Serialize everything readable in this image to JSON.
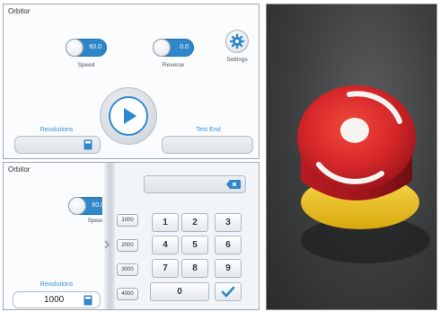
{
  "top_panel": {
    "title": "Orbitor",
    "speed": {
      "value": "60.0",
      "label": "Speed"
    },
    "reverse": {
      "value": "0.0",
      "label": "Reverse"
    },
    "settings_label": "Settings",
    "revolutions_label": "Revolutions",
    "test_end_label": "Test End"
  },
  "bottom_panel": {
    "title": "Orbitor",
    "speed": {
      "value": "60.0",
      "label": "Speed"
    },
    "revolutions_label": "Revolutions",
    "revolutions_value": "1000",
    "presets": [
      "1000",
      "2000",
      "3000",
      "4000"
    ],
    "keys": [
      "1",
      "2",
      "3",
      "4",
      "5",
      "6",
      "7",
      "8",
      "9",
      "0"
    ]
  },
  "colors": {
    "accent": "#2f86c8",
    "label_blue": "#3a8fd0",
    "estop_red": "#d8282a",
    "estop_yellow": "#f2c31a"
  },
  "icons": [
    "gear-icon",
    "play-icon",
    "calculator-icon",
    "backspace-icon",
    "checkmark-icon",
    "chevron-right-icon"
  ]
}
